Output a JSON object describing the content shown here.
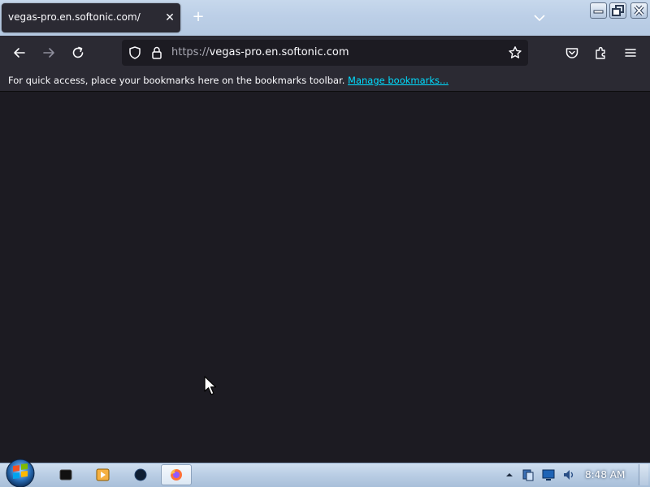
{
  "browser": {
    "tab": {
      "title": "vegas-pro.en.softonic.com/",
      "close_glyph": "✕"
    },
    "new_tab_glyph": "+",
    "url": {
      "scheme": "https://",
      "host": "vegas-pro.en.softonic.com"
    },
    "bookmarks_toolbar": {
      "message": "For quick access, place your bookmarks here on the bookmarks toolbar.",
      "manage_link": "Manage bookmarks..."
    },
    "theme": {
      "toolbar_bg": "#2b2a33",
      "content_bg": "#1c1b22",
      "link_color": "#00ddff"
    },
    "icons": [
      "back-icon",
      "forward-icon",
      "reload-icon",
      "shield-icon",
      "lock-icon",
      "star-icon",
      "pocket-icon",
      "extensions-icon",
      "menu-icon"
    ]
  },
  "taskbar": {
    "clock": "8:48 AM",
    "pinned": [
      "terminal-icon",
      "media-player-icon",
      "app-circle-icon",
      "firefox-icon"
    ],
    "tray": [
      "tray-expand-icon",
      "tray-network-icon",
      "tray-monitor-icon",
      "tray-sound-icon"
    ]
  }
}
